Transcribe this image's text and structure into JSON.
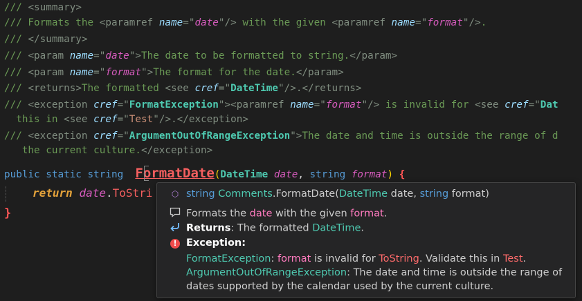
{
  "code": {
    "l1": {
      "p": "/// ",
      "o": "<",
      "tag": "summary",
      "c": ">"
    },
    "l2": {
      "p": "/// Formats the ",
      "o1": "<",
      "tag1": "paramref ",
      "attr": "name",
      "eq": "=\"",
      "val": "date",
      "q": "\"",
      "c1": "/>",
      "mid": " with the given ",
      "o2": "<",
      "tag2": "paramref ",
      "attr2": "name",
      "eq2": "=\"",
      "val2": "format",
      "q2": "\"",
      "c2": "/>",
      "end": "."
    },
    "l3": {
      "p": "/// ",
      "o": "</",
      "tag": "summary",
      "c": ">"
    },
    "l4": {
      "p": "/// ",
      "o": "<",
      "tag": "param ",
      "attr": "name",
      "eq": "=\"",
      "val": "date",
      "q": "\"",
      "c": ">",
      "txt": "The date to be formatted to string.",
      "close": "</param>"
    },
    "l5": {
      "p": "/// ",
      "o": "<",
      "tag": "param ",
      "attr": "name",
      "eq": "=\"",
      "val": "format",
      "q": "\"",
      "c": ">",
      "txt": "The format for the date.",
      "close": "</param>"
    },
    "l6": {
      "p": "/// ",
      "o": "<",
      "tag": "returns",
      "c": ">",
      "txt": "The formatted ",
      "see": "<see ",
      "attr": "cref",
      "eq": "=\"",
      "val": "DateTime",
      "q": "\"",
      "sc": "/>",
      "end": ".</returns>"
    },
    "l7": {
      "p": "/// ",
      "o": "<",
      "tag": "exception ",
      "attr": "cref",
      "eq": "=\"",
      "val": "FormatException",
      "q": "\"",
      "c": ">",
      "pr": "<paramref ",
      "attr2": "name",
      "eq2": "=\"",
      "val2": "format",
      "q2": "\"",
      "pc": "/>",
      "txt": " is invalid for ",
      "see": "<see ",
      "attr3": "cref",
      "eq3": "=\"",
      "val3": "Dat"
    },
    "l8": {
      "indent": "  ",
      "txt": "this in ",
      "see": "<see ",
      "attr": "cref",
      "eq": "=\"",
      "val": "Test",
      "q": "\"",
      "sc": "/>",
      "end": ".</exception>"
    },
    "l9": {
      "p": "/// ",
      "o": "<",
      "tag": "exception ",
      "attr": "cref",
      "eq": "=\"",
      "val": "ArgumentOutOfRangeException",
      "q": "\"",
      "c": ">",
      "txt": "The date and time is outside the range of d"
    },
    "l10": {
      "indent": "   ",
      "txt": "the current culture.",
      "close": "</exception>"
    },
    "l11": {
      "kw1": "public",
      "kw2": "static",
      "kw3": "string",
      "fn": "FormatDate",
      "po": "(",
      "t1": "DateTime",
      "p1": "date",
      "comma": ", ",
      "t2": "string",
      "p2": "format",
      "pc": ")",
      "brace": "{"
    },
    "l12": {
      "kw": "return",
      "obj": "date",
      "dot": ".",
      "mth": "ToStri"
    },
    "l13": {
      "brace": "}"
    }
  },
  "hover": {
    "sig": {
      "ret": "string",
      "cls": "Comments",
      "dot": ".",
      "name": "FormatDate",
      "po": "(",
      "t1": "DateTime",
      "p1": " date, ",
      "t2": "string",
      "p2": " format)"
    },
    "summary": {
      "a": "Formats the ",
      "p1": "date",
      "b": " with the given ",
      "p2": "format",
      "c": "."
    },
    "returns": {
      "label": "Returns",
      "colon": ": The formatted ",
      "type": "DateTime",
      "end": "."
    },
    "exception": {
      "label": "Exception:",
      "e1": {
        "type": "FormatException",
        "colon": ": ",
        "prm": "format",
        "a": " is invalid for ",
        "mth": "ToString",
        "b": ". Validate this in ",
        "test": "Test",
        "c": "."
      },
      "e2": {
        "type": "ArgumentOutOfRangeException",
        "text": ": The date and time is outside the range of dates supported by the calendar used by the current culture."
      }
    },
    "icons": {
      "symbol": "cube-icon",
      "summary": "comment-icon",
      "returns": "return-arrow-icon",
      "exception": "error-icon"
    }
  },
  "colors": {
    "background": "#1e1e1e",
    "comment": "#6a9955",
    "keyword": "#569cd6",
    "type": "#4ec9b0",
    "method": "#f55f5f",
    "parameter": "#d65bbd",
    "hover_bg": "#252526"
  }
}
